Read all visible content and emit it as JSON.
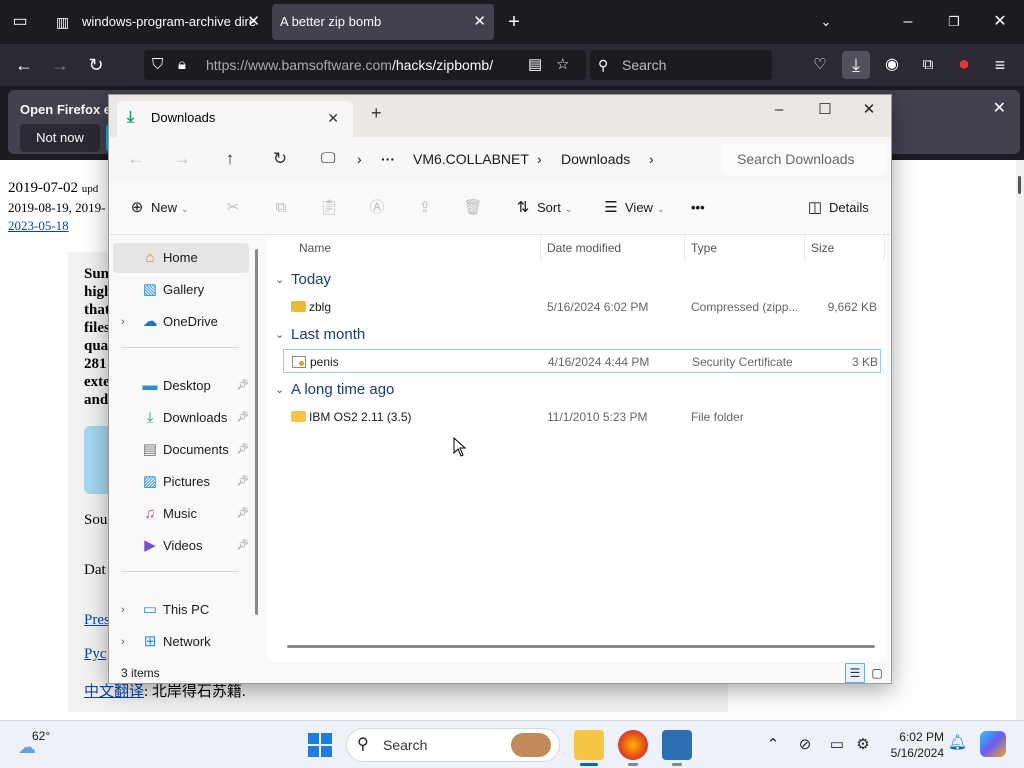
{
  "browser": {
    "tabs": [
      {
        "label": "windows-program-archive dire",
        "active": false
      },
      {
        "label": "A better zip bomb",
        "active": true
      }
    ],
    "url_host": "https://www.bamsoftware.com",
    "url_path": "/hacks/zipbomb/",
    "search_placeholder": "Search",
    "notification": {
      "title": "Open Firefox ev",
      "button": "Not now"
    }
  },
  "page": {
    "date1": "2019-07-02",
    "date1_suffix": "upd",
    "date2": "2019-08-19, 2019-",
    "date3": "2023-05-18",
    "lines": [
      "Sun",
      "high",
      "that",
      "files",
      "quad",
      "281",
      "exte",
      "and"
    ],
    "sou": "Sou",
    "dat": "Dat",
    "link1": "Pres",
    "link2": "Pyc",
    "link3": "中文翻译",
    "link3_suffix": ": 北岸得石苏籍."
  },
  "explorer": {
    "tab_title": "Downloads",
    "breadcrumb": [
      "VM6.COLLABNET",
      "Downloads"
    ],
    "search_placeholder": "Search Downloads",
    "commands": {
      "new": "New",
      "sort": "Sort",
      "view": "View",
      "details": "Details"
    },
    "nav": {
      "home": "Home",
      "gallery": "Gallery",
      "onedrive": "OneDrive",
      "desktop": "Desktop",
      "downloads": "Downloads",
      "documents": "Documents",
      "pictures": "Pictures",
      "music": "Music",
      "videos": "Videos",
      "thispc": "This PC",
      "network": "Network"
    },
    "columns": {
      "name": "Name",
      "date": "Date modified",
      "type": "Type",
      "size": "Size"
    },
    "groups": [
      {
        "title": "Today",
        "files": [
          {
            "name": "zblg",
            "date": "5/16/2024 6:02 PM",
            "type": "Compressed (zipp...",
            "size": "9,662 KB",
            "icon": "zip-folder-icon"
          }
        ]
      },
      {
        "title": "Last month",
        "files": [
          {
            "name": "penis",
            "date": "4/16/2024 4:44 PM",
            "type": "Security Certificate",
            "size": "3 KB",
            "icon": "certificate-icon"
          }
        ]
      },
      {
        "title": "A long time ago",
        "files": [
          {
            "name": "IBM OS2 2.11 (3.5)",
            "date": "11/1/2010 5:23 PM",
            "type": "File folder",
            "size": "",
            "icon": "folder-icon"
          }
        ]
      }
    ],
    "status": "3 items"
  },
  "taskbar": {
    "temperature": "62°",
    "search_placeholder": "Search",
    "time": "6:02 PM",
    "date": "5/16/2024"
  },
  "colors": {
    "accent": "#0067c0",
    "firefox_dark": "#1c1b22",
    "folder": "#f6c247"
  }
}
